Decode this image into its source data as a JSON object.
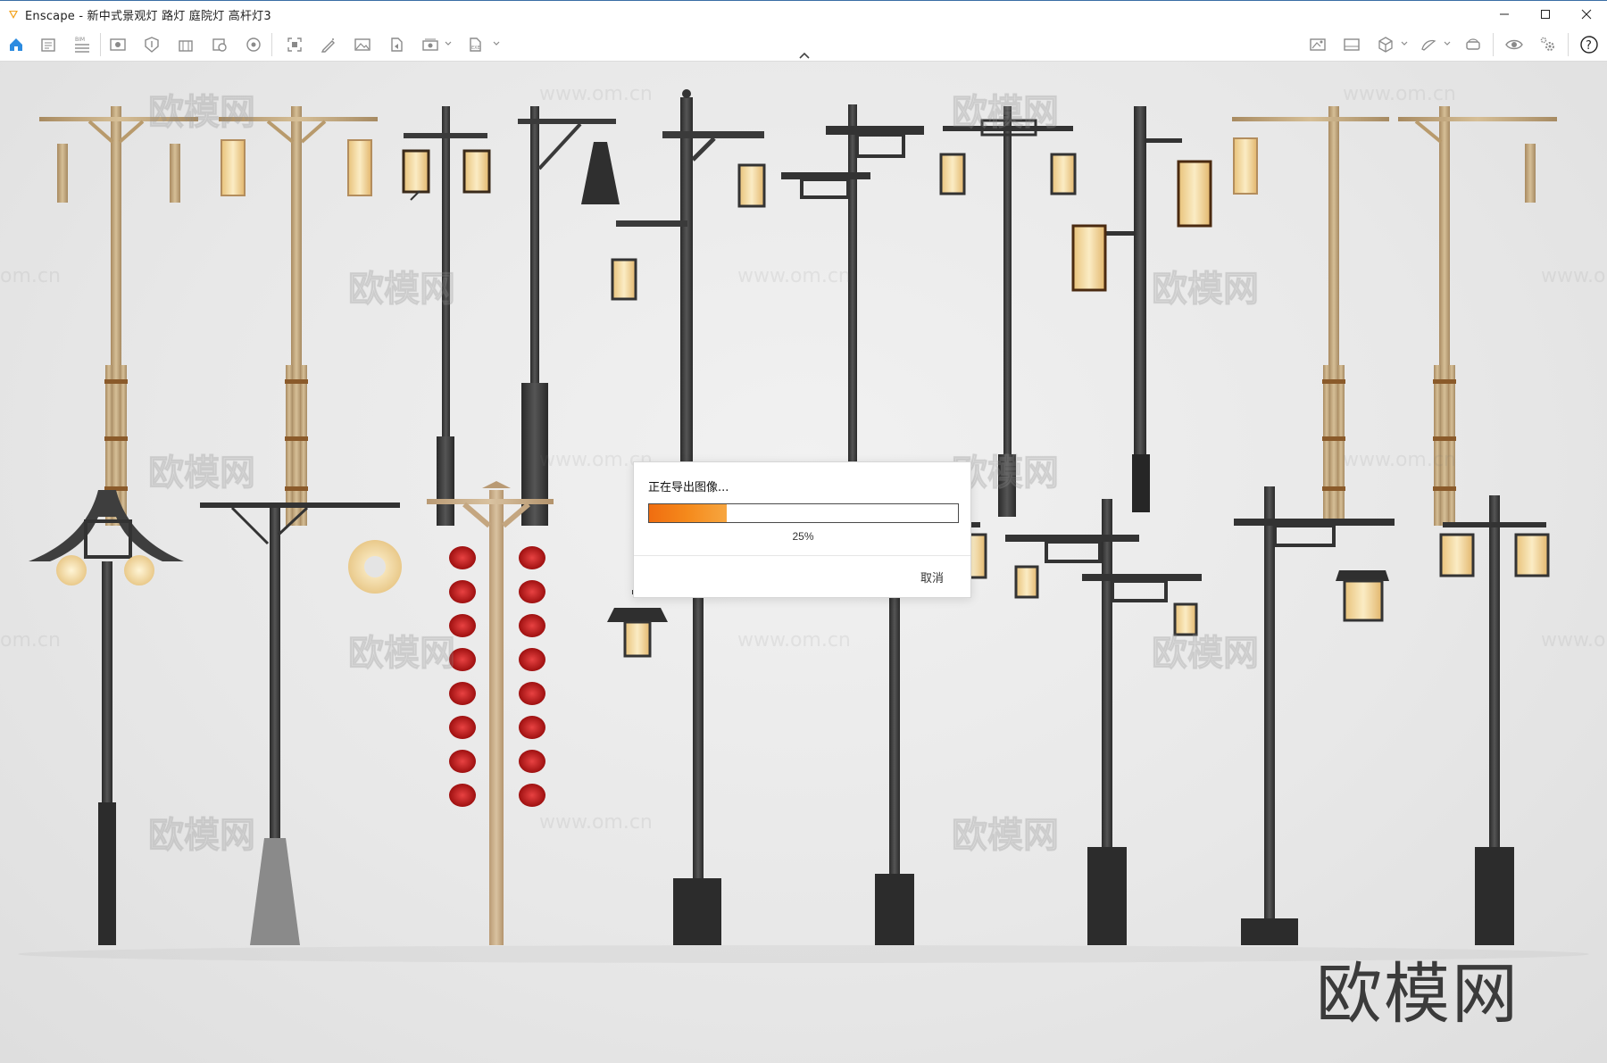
{
  "window": {
    "title": "Enscape - 新中式景观灯 路灯 庭院灯 高杆灯3",
    "controls": [
      "minimize",
      "maximize",
      "close"
    ]
  },
  "toolbar": {
    "left_icons": [
      "home-icon",
      "project-info-icon",
      "bim-icon",
      "view-icon",
      "asset-library-icon",
      "material-editor-icon",
      "capture-icon",
      "panorama-icon",
      "screenshot-icon",
      "pencil-icon",
      "gallery-icon",
      "export-icon",
      "batch-render-icon",
      "exe-export-icon"
    ],
    "right_icons": [
      "visual-settings-icon",
      "image-settings-icon",
      "cube-icon",
      "walk-mode-icon",
      "vr-headset-icon",
      "eye-icon",
      "settings-gear-icon",
      "help-icon"
    ],
    "bim_label": "BIM"
  },
  "dialog": {
    "title": "正在导出图像...",
    "progress_percent": 25,
    "progress_text": "25%",
    "cancel_label": "取消"
  },
  "watermark": {
    "brand": "欧模网",
    "url": "www.om.cn",
    "short": "om.cn"
  },
  "colors": {
    "accent": "#f08a1c",
    "bamboo": "#c9ae84",
    "metal": "#3c3c3c",
    "lantern_glow": "#f3d79a",
    "red_lantern": "#c81e1e"
  }
}
